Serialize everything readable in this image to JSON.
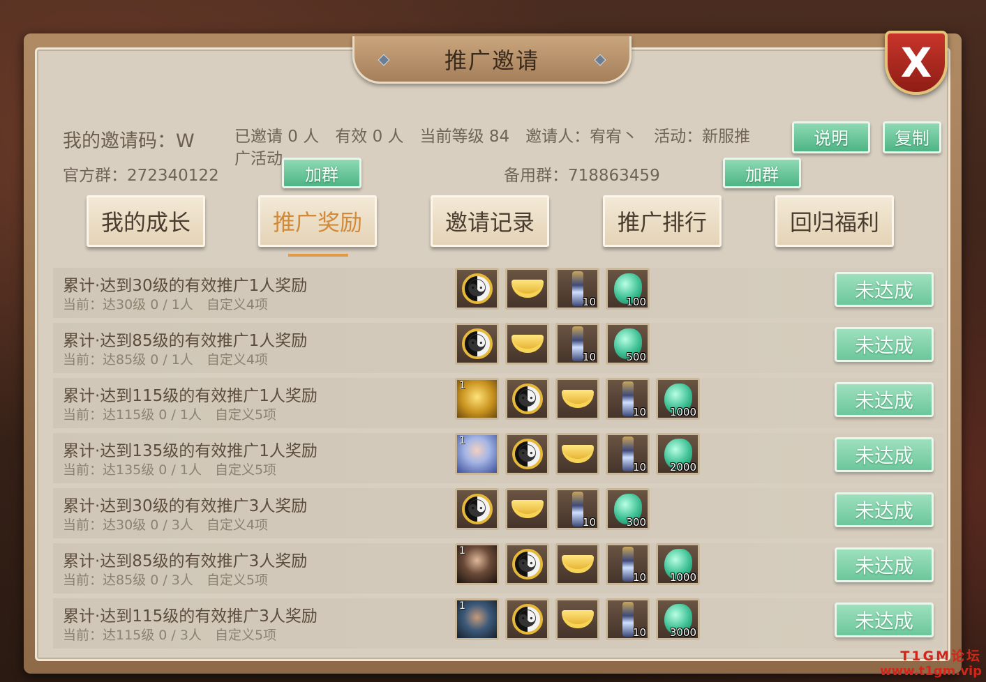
{
  "title": "推广邀请",
  "close_label": "X",
  "info": {
    "invite_code": "我的邀请码：W",
    "stats": "已邀请 0 人　有效 0 人　当前等级 84　邀请人：宥宥丶　活动：新服推广活动",
    "official_group": "官方群：272340122",
    "backup_group": "备用群：718863459"
  },
  "buttons": {
    "explain": "说明",
    "copy": "复制",
    "join_group_1": "加群",
    "join_group_2": "加群"
  },
  "tabs": [
    {
      "label": "我的成长",
      "active": false
    },
    {
      "label": "推广奖励",
      "active": true
    },
    {
      "label": "邀请记录",
      "active": false
    },
    {
      "label": "推广排行",
      "active": false
    },
    {
      "label": "回归福利",
      "active": false
    }
  ],
  "rows": [
    {
      "title": "累计·达到30级的有效推广1人奖励",
      "sub": "当前：达30级 0 / 1人　自定义4项",
      "status": "未达成",
      "items": [
        {
          "icon": "taiji-icon"
        },
        {
          "icon": "gold-ingot-icon"
        },
        {
          "icon": "scroll-icon",
          "count": "10"
        },
        {
          "icon": "jade-dragon-icon",
          "count": "100"
        }
      ]
    },
    {
      "title": "累计·达到85级的有效推广1人奖励",
      "sub": "当前：达85级 0 / 1人　自定义4项",
      "status": "未达成",
      "items": [
        {
          "icon": "taiji-icon"
        },
        {
          "icon": "gold-ingot-icon"
        },
        {
          "icon": "scroll-icon",
          "count": "10"
        },
        {
          "icon": "jade-dragon-icon",
          "count": "500"
        }
      ]
    },
    {
      "title": "累计·达到115级的有效推广1人奖励",
      "sub": "当前：达115级 0 / 1人　自定义5项",
      "status": "未达成",
      "items": [
        {
          "icon": "gold-statue-icon",
          "level": "1"
        },
        {
          "icon": "taiji-icon"
        },
        {
          "icon": "gold-ingot-icon"
        },
        {
          "icon": "scroll-icon",
          "count": "10"
        },
        {
          "icon": "jade-dragon-icon",
          "count": "1000"
        }
      ]
    },
    {
      "title": "累计·达到135级的有效推广1人奖励",
      "sub": "当前：达135级 0 / 1人　自定义5项",
      "status": "未达成",
      "items": [
        {
          "icon": "hero-blue-icon",
          "level": "1"
        },
        {
          "icon": "taiji-icon"
        },
        {
          "icon": "gold-ingot-icon"
        },
        {
          "icon": "scroll-icon",
          "count": "10"
        },
        {
          "icon": "jade-dragon-icon",
          "count": "2000"
        }
      ]
    },
    {
      "title": "累计·达到30级的有效推广3人奖励",
      "sub": "当前：达30级 0 / 3人　自定义4项",
      "status": "未达成",
      "items": [
        {
          "icon": "taiji-icon"
        },
        {
          "icon": "gold-ingot-icon"
        },
        {
          "icon": "scroll-icon",
          "count": "10"
        },
        {
          "icon": "jade-dragon-icon",
          "count": "300"
        }
      ]
    },
    {
      "title": "累计·达到85级的有效推广3人奖励",
      "sub": "当前：达85级 0 / 3人　自定义5项",
      "status": "未达成",
      "items": [
        {
          "icon": "hero-dark-icon",
          "level": "1"
        },
        {
          "icon": "taiji-icon"
        },
        {
          "icon": "gold-ingot-icon"
        },
        {
          "icon": "scroll-icon",
          "count": "10"
        },
        {
          "icon": "jade-dragon-icon",
          "count": "1000"
        }
      ]
    },
    {
      "title": "累计·达到115级的有效推广3人奖励",
      "sub": "当前：达115级 0 / 3人　自定义5项",
      "status": "未达成",
      "items": [
        {
          "icon": "hero-warrior-icon",
          "level": "1"
        },
        {
          "icon": "taiji-icon"
        },
        {
          "icon": "gold-ingot-icon"
        },
        {
          "icon": "scroll-icon",
          "count": "10"
        },
        {
          "icon": "jade-dragon-icon",
          "count": "3000"
        }
      ]
    }
  ],
  "watermark": {
    "line1": "T1GM论坛",
    "line2": "www.t1gm.vip"
  },
  "colors": {
    "accent_tab": "#d18a3a",
    "green_button": "#6cc79b",
    "close_red": "#c8352a"
  }
}
